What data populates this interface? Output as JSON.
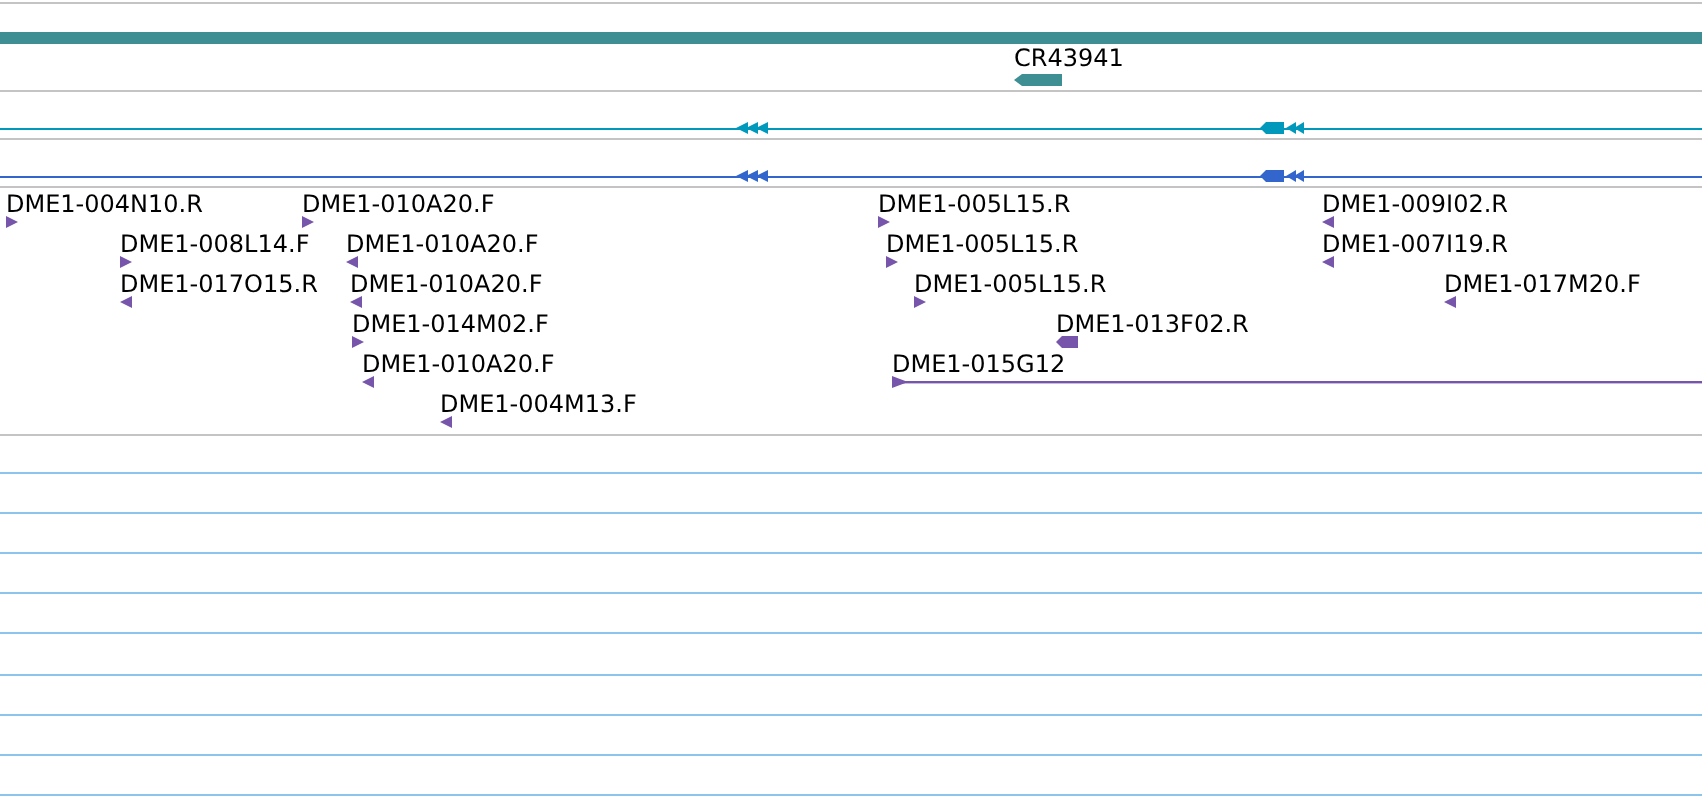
{
  "gene_track": {
    "label": "CR43941",
    "reverse": true
  },
  "features": [
    {
      "label": "DME1-004N10.R",
      "reverse": false,
      "kind": "marker"
    },
    {
      "label": "DME1-010A20.F",
      "reverse": false,
      "kind": "marker"
    },
    {
      "label": "DME1-005L15.R",
      "reverse": false,
      "kind": "marker"
    },
    {
      "label": "DME1-009I02.R",
      "reverse": true,
      "kind": "marker"
    },
    {
      "label": "DME1-008L14.F",
      "reverse": false,
      "kind": "marker"
    },
    {
      "label": "DME1-010A20.F",
      "reverse": true,
      "kind": "marker"
    },
    {
      "label": "DME1-005L15.R",
      "reverse": false,
      "kind": "marker"
    },
    {
      "label": "DME1-007I19.R",
      "reverse": true,
      "kind": "marker"
    },
    {
      "label": "DME1-017O15.R",
      "reverse": true,
      "kind": "marker"
    },
    {
      "label": "DME1-010A20.F",
      "reverse": true,
      "kind": "marker"
    },
    {
      "label": "DME1-005L15.R",
      "reverse": false,
      "kind": "marker"
    },
    {
      "label": "DME1-017M20.F",
      "reverse": true,
      "kind": "marker"
    },
    {
      "label": "DME1-014M02.F",
      "reverse": false,
      "kind": "marker"
    },
    {
      "label": "DME1-013F02.R",
      "reverse": true,
      "kind": "block"
    },
    {
      "label": "DME1-010A20.F",
      "reverse": true,
      "kind": "marker"
    },
    {
      "label": "DME1-015G12",
      "reverse": false,
      "kind": "span"
    },
    {
      "label": "DME1-004M13.F",
      "reverse": true,
      "kind": "marker"
    }
  ]
}
